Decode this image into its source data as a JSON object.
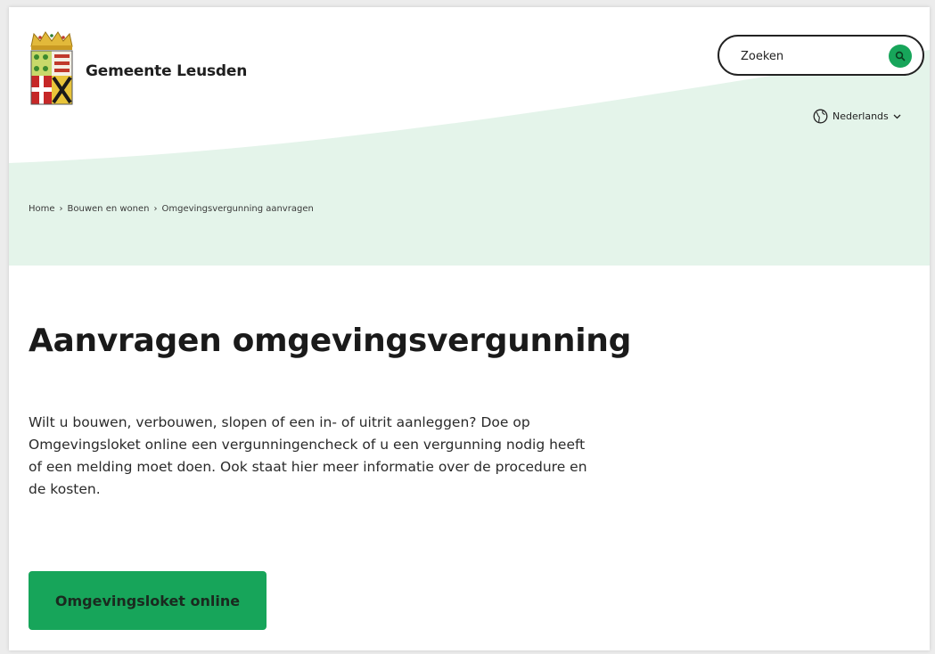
{
  "header": {
    "site_name": "Gemeente Leusden",
    "search": {
      "placeholder": "Zoeken",
      "icon": "search-icon"
    },
    "language": {
      "label": "Nederlands",
      "icon": "globe-icon",
      "chevron": "chevron-down-icon"
    }
  },
  "breadcrumb": {
    "items": [
      "Home",
      "Bouwen en wonen",
      "Omgevingsvergunning aanvragen"
    ],
    "separator": "›"
  },
  "main": {
    "title": "Aanvragen omgevingsvergunning",
    "intro_lines": [
      "Wilt u bouwen, verbouwen, slopen of een in- of uitrit aanleggen? Doe op",
      "Omgevingsloket online een vergunningencheck of u een vergunning nodig heeft",
      "of een melding moet doen. Ook staat hier meer informatie over de procedure en",
      "de kosten."
    ],
    "cta_label": "Omgevingsloket online"
  },
  "colors": {
    "accent_green": "#17a55a",
    "hero_mint": "#e4f4ea",
    "text": "#1e1e1e"
  }
}
